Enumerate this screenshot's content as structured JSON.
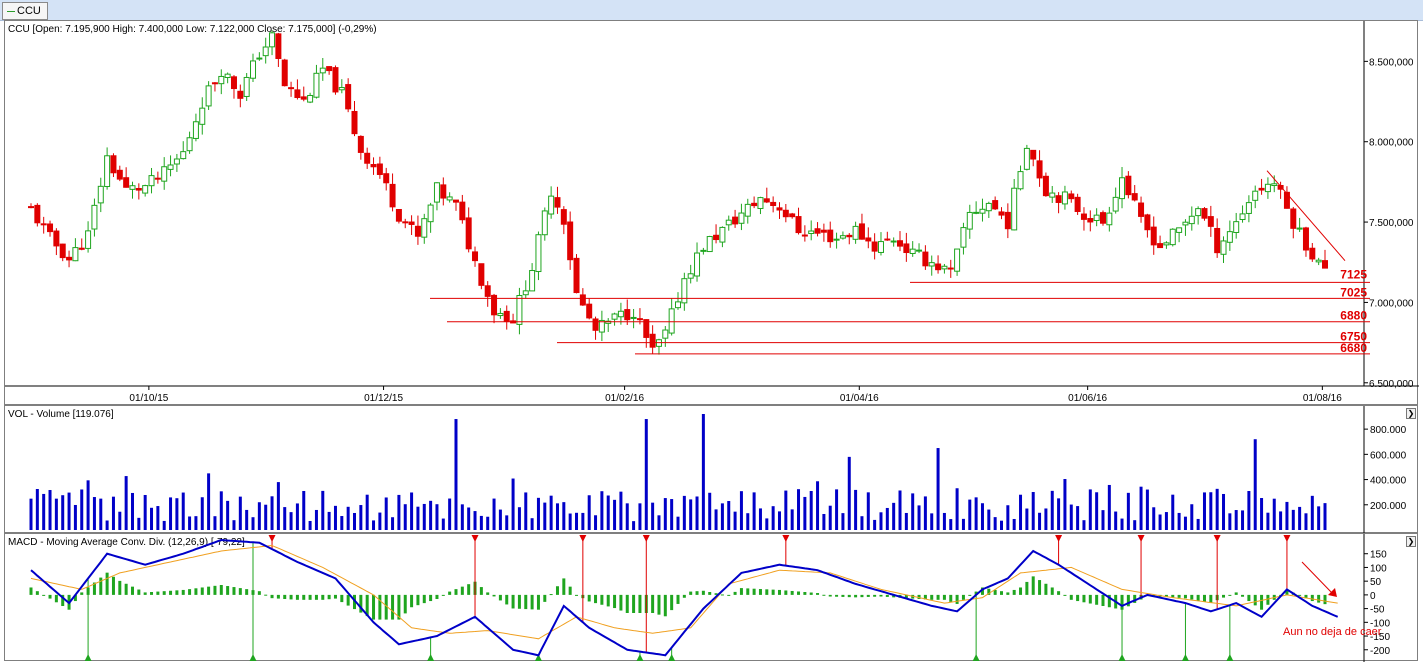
{
  "tab": {
    "label": "CCU"
  },
  "price_panel": {
    "label": "CCU [Open: 7.195,900  High: 7.400,000  Low: 7.122,000  Close: 7.175,000] (-0,29%)",
    "y_ticks": [
      "8.500,000",
      "8.000,000",
      "7.500,000",
      "7.000,000",
      "6.500,000"
    ],
    "x_ticks": [
      "01/10/15",
      "01/12/15",
      "01/02/16",
      "01/04/16",
      "01/06/16",
      "01/08/16"
    ],
    "level_labels": [
      "7125",
      "7025",
      "6880",
      "6750",
      "6680"
    ]
  },
  "volume_panel": {
    "label": "VOL - Volume [119.076]",
    "y_ticks": [
      "800.000",
      "600.000",
      "400.000",
      "200.000"
    ]
  },
  "macd_panel": {
    "label": "MACD - Moving Average Conv. Div. (12,26,9) [-79,22]",
    "y_ticks": [
      "150",
      "100",
      "50",
      "0",
      "-50",
      "-100",
      "-150",
      "-200"
    ],
    "annotation": "Aun no deja de caer"
  },
  "colors": {
    "up": "#1fa51f",
    "down": "#e00000",
    "volume": "#0000c8",
    "macd": "#0000c8",
    "signal": "#f0a020",
    "histogram": "#1fa51f",
    "level": "#e00000"
  },
  "chart_data": [
    {
      "type": "candlestick",
      "title": "CCU",
      "x_ticks": [
        "01/10/15",
        "01/12/15",
        "01/02/16",
        "01/04/16",
        "01/06/16",
        "01/08/16"
      ],
      "ylim": [
        6480,
        8720
      ],
      "close_path": [
        {
          "x": 0,
          "y": 7580
        },
        {
          "x": 3,
          "y": 7400
        },
        {
          "x": 6,
          "y": 7270
        },
        {
          "x": 9,
          "y": 7420
        },
        {
          "x": 12,
          "y": 7900
        },
        {
          "x": 15,
          "y": 7700
        },
        {
          "x": 18,
          "y": 7720
        },
        {
          "x": 21,
          "y": 7800
        },
        {
          "x": 24,
          "y": 7930
        },
        {
          "x": 27,
          "y": 8250
        },
        {
          "x": 30,
          "y": 8450
        },
        {
          "x": 33,
          "y": 8300
        },
        {
          "x": 36,
          "y": 8550
        },
        {
          "x": 38,
          "y": 8650
        },
        {
          "x": 40,
          "y": 8350
        },
        {
          "x": 43,
          "y": 8250
        },
        {
          "x": 46,
          "y": 8450
        },
        {
          "x": 49,
          "y": 8300
        },
        {
          "x": 52,
          "y": 7950
        },
        {
          "x": 55,
          "y": 7800
        },
        {
          "x": 58,
          "y": 7550
        },
        {
          "x": 61,
          "y": 7400
        },
        {
          "x": 64,
          "y": 7700
        },
        {
          "x": 67,
          "y": 7600
        },
        {
          "x": 70,
          "y": 7250
        },
        {
          "x": 73,
          "y": 6950
        },
        {
          "x": 76,
          "y": 6900
        },
        {
          "x": 79,
          "y": 7220
        },
        {
          "x": 82,
          "y": 7700
        },
        {
          "x": 84,
          "y": 7520
        },
        {
          "x": 86,
          "y": 7050
        },
        {
          "x": 89,
          "y": 6820
        },
        {
          "x": 92,
          "y": 6900
        },
        {
          "x": 95,
          "y": 6950
        },
        {
          "x": 98,
          "y": 6690
        },
        {
          "x": 100,
          "y": 6800
        },
        {
          "x": 103,
          "y": 7150
        },
        {
          "x": 106,
          "y": 7350
        },
        {
          "x": 109,
          "y": 7450
        },
        {
          "x": 112,
          "y": 7550
        },
        {
          "x": 115,
          "y": 7650
        },
        {
          "x": 118,
          "y": 7600
        },
        {
          "x": 121,
          "y": 7450
        },
        {
          "x": 124,
          "y": 7430
        },
        {
          "x": 127,
          "y": 7400
        },
        {
          "x": 130,
          "y": 7450
        },
        {
          "x": 133,
          "y": 7350
        },
        {
          "x": 136,
          "y": 7400
        },
        {
          "x": 139,
          "y": 7300
        },
        {
          "x": 142,
          "y": 7250
        },
        {
          "x": 145,
          "y": 7180
        },
        {
          "x": 148,
          "y": 7550
        },
        {
          "x": 151,
          "y": 7620
        },
        {
          "x": 154,
          "y": 7500
        },
        {
          "x": 157,
          "y": 8000
        },
        {
          "x": 160,
          "y": 7700
        },
        {
          "x": 163,
          "y": 7650
        },
        {
          "x": 166,
          "y": 7550
        },
        {
          "x": 169,
          "y": 7500
        },
        {
          "x": 172,
          "y": 7780
        },
        {
          "x": 175,
          "y": 7500
        },
        {
          "x": 178,
          "y": 7350
        },
        {
          "x": 181,
          "y": 7450
        },
        {
          "x": 184,
          "y": 7600
        },
        {
          "x": 187,
          "y": 7350
        },
        {
          "x": 190,
          "y": 7500
        },
        {
          "x": 193,
          "y": 7700
        },
        {
          "x": 196,
          "y": 7750
        },
        {
          "x": 199,
          "y": 7500
        },
        {
          "x": 202,
          "y": 7300
        },
        {
          "x": 204,
          "y": 7190
        }
      ],
      "levels": [
        7125,
        7025,
        6880,
        6750,
        6680
      ]
    },
    {
      "type": "bar",
      "title": "VOL - Volume",
      "ylim": [
        0,
        920000
      ],
      "y_ticks": [
        200000,
        400000,
        600000,
        800000
      ],
      "peaks": [
        {
          "x": 67,
          "y": 880000
        },
        {
          "x": 97,
          "y": 880000
        },
        {
          "x": 106,
          "y": 920000
        },
        {
          "x": 193,
          "y": 720000
        },
        {
          "x": 143,
          "y": 650000
        },
        {
          "x": 129,
          "y": 580000
        }
      ]
    },
    {
      "type": "line",
      "title": "MACD - Moving Average Conv. Div. (12,26,9)",
      "ylim": [
        -230,
        200
      ],
      "series": [
        {
          "name": "MACD",
          "values": [
            {
              "x": 0,
              "y": 90
            },
            {
              "x": 6,
              "y": -30
            },
            {
              "x": 12,
              "y": 150
            },
            {
              "x": 18,
              "y": 110
            },
            {
              "x": 24,
              "y": 150
            },
            {
              "x": 30,
              "y": 200
            },
            {
              "x": 36,
              "y": 190
            },
            {
              "x": 42,
              "y": 120
            },
            {
              "x": 48,
              "y": 60
            },
            {
              "x": 54,
              "y": -100
            },
            {
              "x": 58,
              "y": -180
            },
            {
              "x": 64,
              "y": -150
            },
            {
              "x": 70,
              "y": -80
            },
            {
              "x": 76,
              "y": -200
            },
            {
              "x": 80,
              "y": -220
            },
            {
              "x": 84,
              "y": -40
            },
            {
              "x": 88,
              "y": -120
            },
            {
              "x": 94,
              "y": -200
            },
            {
              "x": 100,
              "y": -220
            },
            {
              "x": 106,
              "y": -50
            },
            {
              "x": 112,
              "y": 80
            },
            {
              "x": 118,
              "y": 110
            },
            {
              "x": 124,
              "y": 90
            },
            {
              "x": 130,
              "y": 40
            },
            {
              "x": 136,
              "y": 0
            },
            {
              "x": 142,
              "y": -40
            },
            {
              "x": 146,
              "y": -60
            },
            {
              "x": 150,
              "y": 20
            },
            {
              "x": 154,
              "y": 60
            },
            {
              "x": 158,
              "y": 160
            },
            {
              "x": 162,
              "y": 110
            },
            {
              "x": 168,
              "y": 20
            },
            {
              "x": 172,
              "y": -40
            },
            {
              "x": 176,
              "y": 0
            },
            {
              "x": 182,
              "y": -30
            },
            {
              "x": 186,
              "y": -60
            },
            {
              "x": 190,
              "y": -30
            },
            {
              "x": 194,
              "y": -80
            },
            {
              "x": 198,
              "y": 20
            },
            {
              "x": 202,
              "y": -40
            },
            {
              "x": 206,
              "y": -80
            }
          ]
        },
        {
          "name": "Signal",
          "values": [
            {
              "x": 0,
              "y": 60
            },
            {
              "x": 8,
              "y": 20
            },
            {
              "x": 14,
              "y": 80
            },
            {
              "x": 22,
              "y": 120
            },
            {
              "x": 30,
              "y": 160
            },
            {
              "x": 38,
              "y": 180
            },
            {
              "x": 46,
              "y": 100
            },
            {
              "x": 54,
              "y": 0
            },
            {
              "x": 60,
              "y": -120
            },
            {
              "x": 66,
              "y": -140
            },
            {
              "x": 72,
              "y": -130
            },
            {
              "x": 80,
              "y": -160
            },
            {
              "x": 86,
              "y": -80
            },
            {
              "x": 92,
              "y": -120
            },
            {
              "x": 98,
              "y": -140
            },
            {
              "x": 104,
              "y": -120
            },
            {
              "x": 110,
              "y": 40
            },
            {
              "x": 118,
              "y": 90
            },
            {
              "x": 126,
              "y": 80
            },
            {
              "x": 134,
              "y": 20
            },
            {
              "x": 144,
              "y": -30
            },
            {
              "x": 150,
              "y": -10
            },
            {
              "x": 156,
              "y": 80
            },
            {
              "x": 164,
              "y": 100
            },
            {
              "x": 172,
              "y": 20
            },
            {
              "x": 180,
              "y": -10
            },
            {
              "x": 190,
              "y": -40
            },
            {
              "x": 198,
              "y": 0
            },
            {
              "x": 206,
              "y": -30
            }
          ]
        }
      ]
    }
  ]
}
